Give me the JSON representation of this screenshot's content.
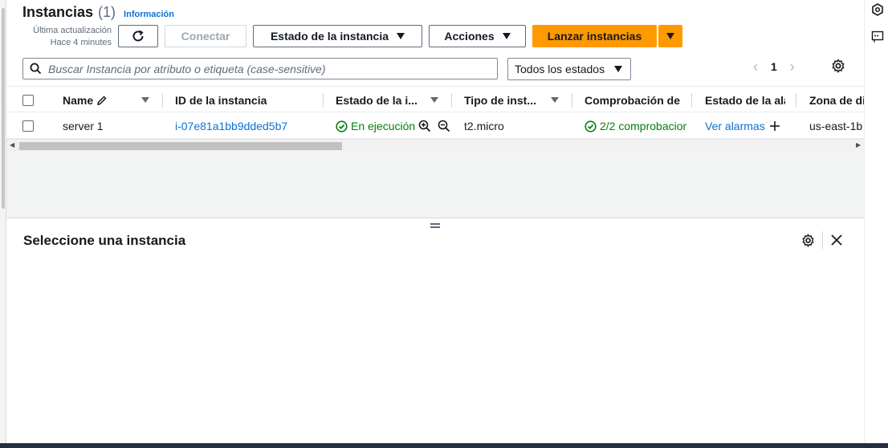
{
  "header": {
    "title": "Instancias",
    "count": "(1)",
    "info_link": "Información",
    "last_update_label": "Última actualización",
    "last_update_value": "Hace 4 minutes"
  },
  "toolbar": {
    "refresh_icon": "refresh-icon",
    "connect": "Conectar",
    "instance_state": "Estado de la instancia",
    "actions": "Acciones",
    "launch": "Lanzar instancias"
  },
  "filter": {
    "search_placeholder": "Buscar Instancia por atributo o etiqueta (case-sensitive)",
    "state_select": "Todos los estados"
  },
  "pagination": {
    "current_page": "1"
  },
  "table": {
    "columns": [
      "Name",
      "ID de la instancia",
      "Estado de la i...",
      "Tipo de inst...",
      "Comprobación de",
      "Estado de la ala",
      "Zona de di"
    ],
    "rows": [
      {
        "name": "server 1",
        "instance_id": "i-07e81a1bb9dded5b7",
        "state": "En ejecución",
        "type": "t2.micro",
        "check": "2/2 comprobacior",
        "alarms": "Ver alarmas",
        "zone": "us-east-1b"
      }
    ]
  },
  "detail": {
    "title": "Seleccione una instancia"
  },
  "colors": {
    "primary": "#ff9900",
    "link": "#0972d3",
    "success": "#037f0c"
  }
}
